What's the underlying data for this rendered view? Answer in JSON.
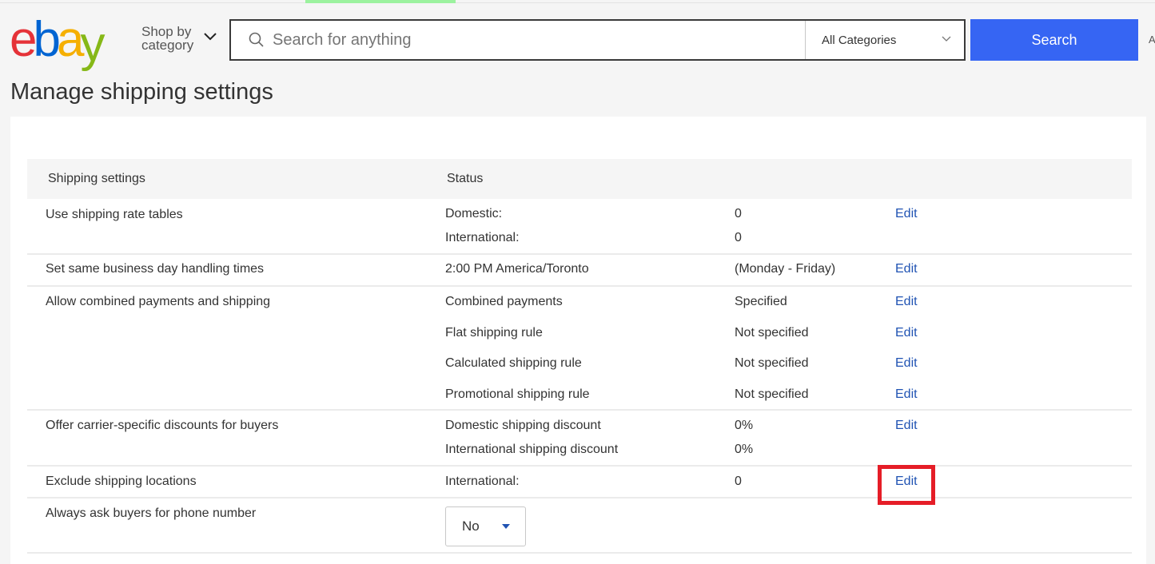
{
  "header": {
    "logo": {
      "letters": [
        "e",
        "b",
        "a",
        "y"
      ]
    },
    "shop_by_category": {
      "line1": "Shop by",
      "line2": "category"
    },
    "search": {
      "placeholder": "Search for anything",
      "value": "",
      "category": "All Categories",
      "button_label": "Search"
    },
    "advanced_link": "A"
  },
  "page": {
    "title": "Manage shipping settings"
  },
  "table": {
    "headers": {
      "setting": "Shipping settings",
      "status": "Status"
    },
    "rows": [
      {
        "name": "Use shipping rate tables",
        "lines": [
          {
            "label": "Domestic:",
            "value": "0",
            "edit": "Edit"
          },
          {
            "label": "International:",
            "value": "0",
            "edit": ""
          }
        ]
      },
      {
        "name": "Set same business day handling times",
        "lines": [
          {
            "label": "2:00 PM America/Toronto",
            "value": "(Monday - Friday)",
            "edit": "Edit"
          }
        ]
      },
      {
        "name": "Allow combined payments and shipping",
        "lines": [
          {
            "label": "Combined payments",
            "value": "Specified",
            "edit": "Edit"
          },
          {
            "label": "Flat shipping rule",
            "value": "Not specified",
            "edit": "Edit"
          },
          {
            "label": "Calculated shipping rule",
            "value": "Not specified",
            "edit": "Edit"
          },
          {
            "label": "Promotional shipping rule",
            "value": "Not specified",
            "edit": "Edit"
          }
        ]
      },
      {
        "name": "Offer carrier-specific discounts for buyers",
        "lines": [
          {
            "label": "Domestic shipping discount",
            "value": "0%",
            "edit": "Edit"
          },
          {
            "label": "International shipping discount",
            "value": "0%",
            "edit": ""
          }
        ]
      },
      {
        "name": "Exclude shipping locations",
        "lines": [
          {
            "label": "International:",
            "value": "0",
            "edit": "Edit",
            "highlighted": true
          }
        ]
      },
      {
        "name": "Always ask buyers for phone number",
        "select_value": "No"
      }
    ]
  },
  "colors": {
    "accent": "#3665f3",
    "link": "#2053b3",
    "highlight": "#e51d27"
  }
}
